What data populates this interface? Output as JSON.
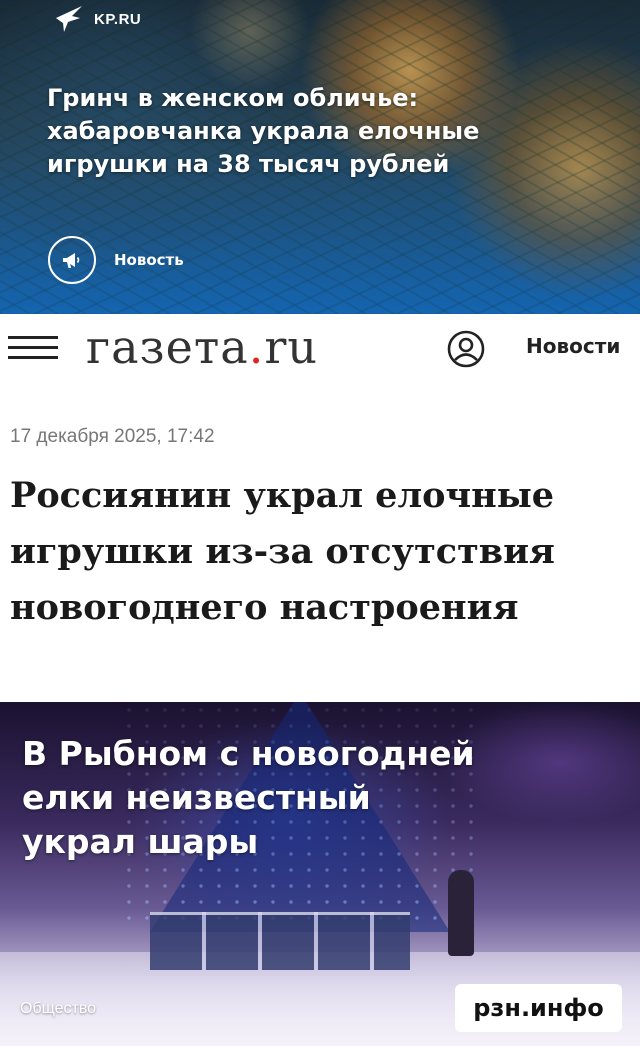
{
  "kp": {
    "logo_text": "KP.RU",
    "headline": "Гринч в женском обличье: хабаровчанка украла елочные игрушки на 38 тысяч рублей",
    "tag_label": "Новость",
    "icons": {
      "logo": "kp-bird-icon",
      "tag": "megaphone-icon"
    }
  },
  "gazeta": {
    "logo_main": "газета",
    "logo_dot": ".",
    "logo_tld": "ru",
    "nav_news": "Новости",
    "date": "17 декабря 2025, 17:42",
    "headline": "Россиянин украл елочные игрушки из-за отсутствия новогоднего настроения",
    "accent_color": "#e0261b",
    "icons": {
      "menu": "hamburger-menu-icon",
      "profile": "user-profile-icon"
    }
  },
  "rzn": {
    "headline": "В Рыбном с новогодней елки неизвестный украл шары",
    "rubric": "Общество",
    "source_badge": "рзн.инфо"
  }
}
